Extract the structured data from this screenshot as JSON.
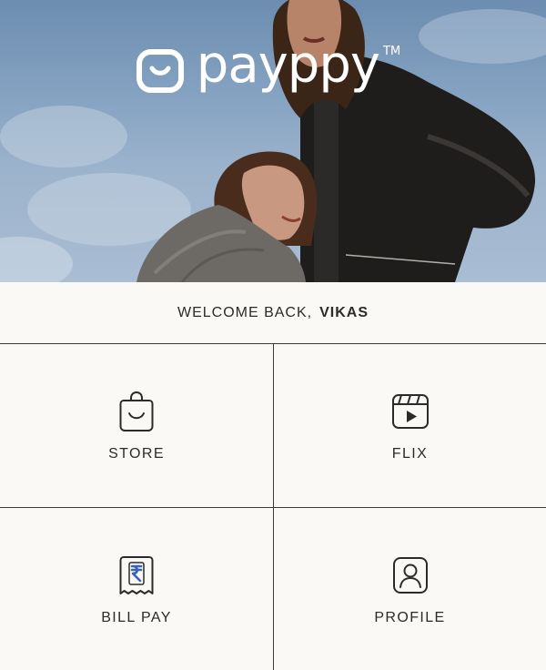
{
  "brand": {
    "name": "payppy",
    "trademark": "TM",
    "logo_icon": "smile-bag-icon"
  },
  "welcome": {
    "prefix": "WELCOME BACK,",
    "user_name": "VIKAS"
  },
  "menu": [
    {
      "label": "STORE",
      "icon": "shopping-bag-icon"
    },
    {
      "label": "FLIX",
      "icon": "video-clapper-icon"
    },
    {
      "label": "BILL PAY",
      "icon": "receipt-rupee-icon"
    },
    {
      "label": "PROFILE",
      "icon": "profile-card-icon"
    }
  ],
  "colors": {
    "background": "#faf9f5",
    "text": "#2b2b2b",
    "divider": "#3a3a3a",
    "rupee_accent": "#3a63b8"
  }
}
